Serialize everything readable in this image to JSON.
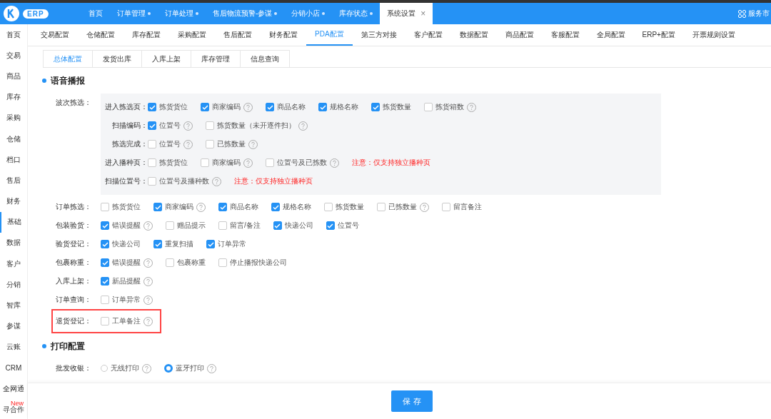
{
  "app": {
    "logo": "ERP"
  },
  "top_tabs": [
    {
      "label": "首页",
      "selected": false,
      "dot": false,
      "closable": false
    },
    {
      "label": "订单管理",
      "selected": false,
      "dot": true,
      "closable": false
    },
    {
      "label": "订单处理",
      "selected": false,
      "dot": true,
      "closable": false
    },
    {
      "label": "售后物流预警-参谋",
      "selected": false,
      "dot": true,
      "closable": false
    },
    {
      "label": "分销小店",
      "selected": false,
      "dot": true,
      "closable": false
    },
    {
      "label": "库存状态",
      "selected": false,
      "dot": true,
      "closable": false
    },
    {
      "label": "系统设置",
      "selected": true,
      "dot": false,
      "closable": true,
      "close": "×"
    }
  ],
  "service_market": "服务市",
  "sidebar": [
    {
      "label": "首页",
      "selected": false
    },
    {
      "label": "交易",
      "selected": false
    },
    {
      "label": "商品",
      "selected": false
    },
    {
      "label": "库存",
      "selected": false
    },
    {
      "label": "采购",
      "selected": false
    },
    {
      "label": "仓储",
      "selected": false
    },
    {
      "label": "档口",
      "selected": false
    },
    {
      "label": "售后",
      "selected": false
    },
    {
      "label": "财务",
      "selected": false
    },
    {
      "label": "基础",
      "selected": true
    },
    {
      "label": "数据",
      "selected": false
    },
    {
      "label": "客户",
      "selected": false
    },
    {
      "label": "分销",
      "selected": false
    },
    {
      "label": "智库",
      "selected": false
    },
    {
      "label": "参谋",
      "selected": false
    },
    {
      "label": "云账",
      "selected": false
    },
    {
      "label": "CRM",
      "selected": false
    },
    {
      "label": "全网通",
      "selected": false
    },
    {
      "label": "寻合作",
      "selected": false,
      "badge": "New"
    }
  ],
  "config_tabs": [
    {
      "label": "交易配置",
      "selected": false
    },
    {
      "label": "仓储配置",
      "selected": false
    },
    {
      "label": "库存配置",
      "selected": false
    },
    {
      "label": "采购配置",
      "selected": false
    },
    {
      "label": "售后配置",
      "selected": false
    },
    {
      "label": "财务配置",
      "selected": false
    },
    {
      "label": "PDA配置",
      "selected": true
    },
    {
      "label": "第三方对接",
      "selected": false
    },
    {
      "label": "客户配置",
      "selected": false
    },
    {
      "label": "数据配置",
      "selected": false
    },
    {
      "label": "商品配置",
      "selected": false
    },
    {
      "label": "客服配置",
      "selected": false
    },
    {
      "label": "全局配置",
      "selected": false
    },
    {
      "label": "ERP+配置",
      "selected": false
    },
    {
      "label": "开票规则设置",
      "selected": false
    }
  ],
  "sub_tabs": [
    {
      "label": "总体配置",
      "selected": true
    },
    {
      "label": "发货出库",
      "selected": false
    },
    {
      "label": "入库上架",
      "selected": false
    },
    {
      "label": "库存管理",
      "selected": false
    },
    {
      "label": "信息查询",
      "selected": false
    }
  ],
  "sections": [
    {
      "title": "语音播报",
      "rows": [
        {
          "label": "波次拣选：",
          "highlighted": false,
          "groups": [
            {
              "label": "进入拣选页：",
              "items": [
                {
                  "kind": "checkbox",
                  "label": "拣货货位",
                  "checked": true,
                  "help": false
                },
                {
                  "kind": "checkbox",
                  "label": "商家编码",
                  "checked": true,
                  "help": true
                },
                {
                  "kind": "checkbox",
                  "label": "商品名称",
                  "checked": true,
                  "help": false
                },
                {
                  "kind": "checkbox",
                  "label": "规格名称",
                  "checked": true,
                  "help": false
                },
                {
                  "kind": "checkbox",
                  "label": "拣货数量",
                  "checked": true,
                  "help": false
                },
                {
                  "kind": "checkbox",
                  "label": "拣货箱数",
                  "checked": false,
                  "help": true
                }
              ]
            },
            {
              "label": "扫描编码：",
              "items": [
                {
                  "kind": "checkbox",
                  "label": "位置号",
                  "checked": true,
                  "help": true
                },
                {
                  "kind": "checkbox",
                  "label": "拣货数量（未开逐件扫）",
                  "checked": false,
                  "help": true
                }
              ]
            },
            {
              "label": "拣选完成：",
              "items": [
                {
                  "kind": "checkbox",
                  "label": "位置号",
                  "checked": false,
                  "help": true
                },
                {
                  "kind": "checkbox",
                  "label": "已拣数量",
                  "checked": false,
                  "help": true
                }
              ]
            },
            {
              "label": "进入播种页：",
              "items": [
                {
                  "kind": "checkbox",
                  "label": "拣货货位",
                  "checked": false,
                  "help": false
                },
                {
                  "kind": "checkbox",
                  "label": "商家编码",
                  "checked": false,
                  "help": true
                },
                {
                  "kind": "checkbox",
                  "label": "位置号及已拣数",
                  "checked": false,
                  "help": true
                },
                {
                  "kind": "note",
                  "text": "注意：仅支持独立播种页"
                }
              ]
            },
            {
              "label": "扫描位置号：",
              "items": [
                {
                  "kind": "checkbox",
                  "label": "位置号及播种数",
                  "checked": false,
                  "help": true
                },
                {
                  "kind": "note",
                  "text": "注意：仅支持独立播种页"
                }
              ]
            }
          ]
        },
        {
          "label": "订单拣选：",
          "highlighted": false,
          "items": [
            {
              "kind": "checkbox",
              "label": "拣货货位",
              "checked": false,
              "help": false
            },
            {
              "kind": "checkbox",
              "label": "商家编码",
              "checked": true,
              "help": true
            },
            {
              "kind": "checkbox",
              "label": "商品名称",
              "checked": true,
              "help": false
            },
            {
              "kind": "checkbox",
              "label": "规格名称",
              "checked": true,
              "help": false
            },
            {
              "kind": "checkbox",
              "label": "拣货数量",
              "checked": false,
              "help": false
            },
            {
              "kind": "checkbox",
              "label": "已拣数量",
              "checked": false,
              "help": true
            },
            {
              "kind": "checkbox",
              "label": "留言备注",
              "checked": false,
              "help": false
            }
          ]
        },
        {
          "label": "包装验货：",
          "highlighted": false,
          "items": [
            {
              "kind": "checkbox",
              "label": "错误提醒",
              "checked": true,
              "help": true
            },
            {
              "kind": "checkbox",
              "label": "赠品提示",
              "checked": false,
              "help": false
            },
            {
              "kind": "checkbox",
              "label": "留言/备注",
              "checked": false,
              "help": false
            },
            {
              "kind": "checkbox",
              "label": "快递公司",
              "checked": true,
              "help": false
            },
            {
              "kind": "checkbox",
              "label": "位置号",
              "checked": true,
              "help": false
            }
          ]
        },
        {
          "label": "验货登记：",
          "highlighted": false,
          "items": [
            {
              "kind": "checkbox",
              "label": "快递公司",
              "checked": true,
              "help": false
            },
            {
              "kind": "checkbox",
              "label": "重复扫描",
              "checked": true,
              "help": false
            },
            {
              "kind": "checkbox",
              "label": "订单异常",
              "checked": true,
              "help": false
            }
          ]
        },
        {
          "label": "包裹称重：",
          "highlighted": false,
          "items": [
            {
              "kind": "checkbox",
              "label": "错误提醒",
              "checked": true,
              "help": true
            },
            {
              "kind": "checkbox",
              "label": "包裹称重",
              "checked": false,
              "help": false
            },
            {
              "kind": "checkbox",
              "label": "停止播报快递公司",
              "checked": false,
              "help": false
            }
          ]
        },
        {
          "label": "入库上架：",
          "highlighted": false,
          "items": [
            {
              "kind": "checkbox",
              "label": "新品提醒",
              "checked": true,
              "help": true
            }
          ]
        },
        {
          "label": "订单查询：",
          "highlighted": false,
          "items": [
            {
              "kind": "checkbox",
              "label": "订单异常",
              "checked": false,
              "help": true
            }
          ]
        },
        {
          "label": "退货登记：",
          "highlighted": true,
          "items": [
            {
              "kind": "checkbox",
              "label": "工单备注",
              "checked": false,
              "help": true
            }
          ]
        }
      ]
    },
    {
      "title": "打印配置",
      "rows": [
        {
          "label": "批发收银：",
          "highlighted": false,
          "items": [
            {
              "kind": "radio",
              "label": "无线打印",
              "selected": false,
              "help": true
            },
            {
              "kind": "radio",
              "label": "蓝牙打印",
              "selected": true,
              "help": true
            }
          ]
        }
      ]
    }
  ],
  "footer": {
    "save": "保 存"
  }
}
